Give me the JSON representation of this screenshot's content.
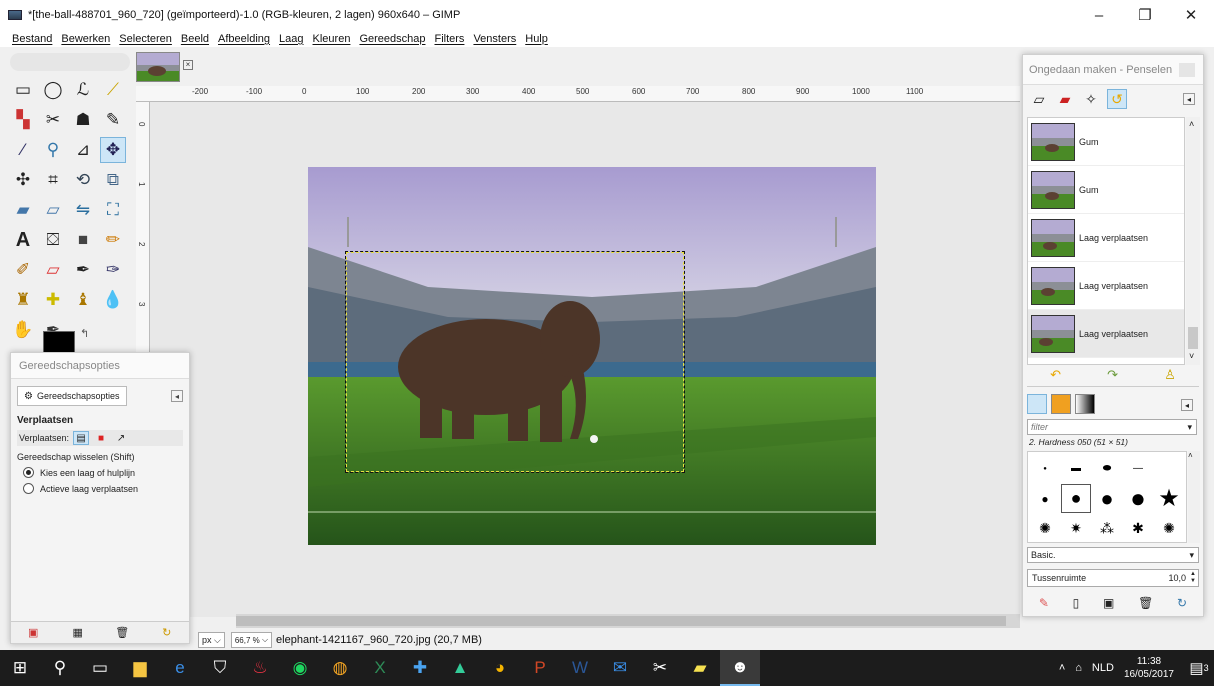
{
  "window": {
    "title": "*[the-ball-488701_960_720] (geïmporteerd)-1.0 (RGB-kleuren, 2 lagen) 960x640 – GIMP",
    "controls": [
      "–",
      "❐",
      "✕"
    ]
  },
  "menubar": [
    "Bestand",
    "Bewerken",
    "Selecteren",
    "Beeld",
    "Afbeelding",
    "Laag",
    "Kleuren",
    "Gereedschap",
    "Filters",
    "Vensters",
    "Hulp"
  ],
  "ruler": {
    "h_labels": [
      "-200",
      "-100",
      "0",
      "100",
      "200",
      "300",
      "400",
      "500",
      "600",
      "700",
      "800",
      "900",
      "1000",
      "1100"
    ],
    "v_labels": [
      "0",
      "1",
      "2",
      "3"
    ]
  },
  "tool_options": {
    "dock_title": "Gereedschapsopties",
    "tab_label": "Gereedschapsopties",
    "heading": "Verplaatsen",
    "move_label": "Verplaatsen:",
    "switch_label": "Gereedschap wisselen (Shift)",
    "options": [
      {
        "label": "Kies een laag of hulplijn",
        "checked": true
      },
      {
        "label": "Actieve laag verplaatsen",
        "checked": false
      }
    ]
  },
  "status": {
    "unit": "px",
    "zoom": "66,7 %",
    "text": "elephant-1421167_960_720.jpg (20,7 MB)"
  },
  "undo_panel": {
    "title": "Ongedaan maken - Penselen",
    "items": [
      {
        "label": "Gum",
        "selected": false
      },
      {
        "label": "Gum",
        "selected": false
      },
      {
        "label": "Laag verplaatsen",
        "selected": false
      },
      {
        "label": "Laag verplaatsen",
        "selected": false
      },
      {
        "label": "Laag verplaatsen",
        "selected": true
      }
    ]
  },
  "brushes": {
    "filter_placeholder": "filter",
    "selected_brush": "2. Hardness 050 (51 × 51)",
    "preset": "Basic.",
    "spacing_label": "Tussenruimte",
    "spacing_value": "10,0"
  },
  "taskbar": {
    "language": "NLD",
    "time": "11:38",
    "date": "16/05/2017",
    "notifications": "3"
  },
  "colors": {
    "foreground": "#000000",
    "accent_selection": "#cde6f7",
    "taskbar": "#1c1c1c",
    "grass": "#3f7d1e",
    "sky": "#b9b0d6"
  }
}
